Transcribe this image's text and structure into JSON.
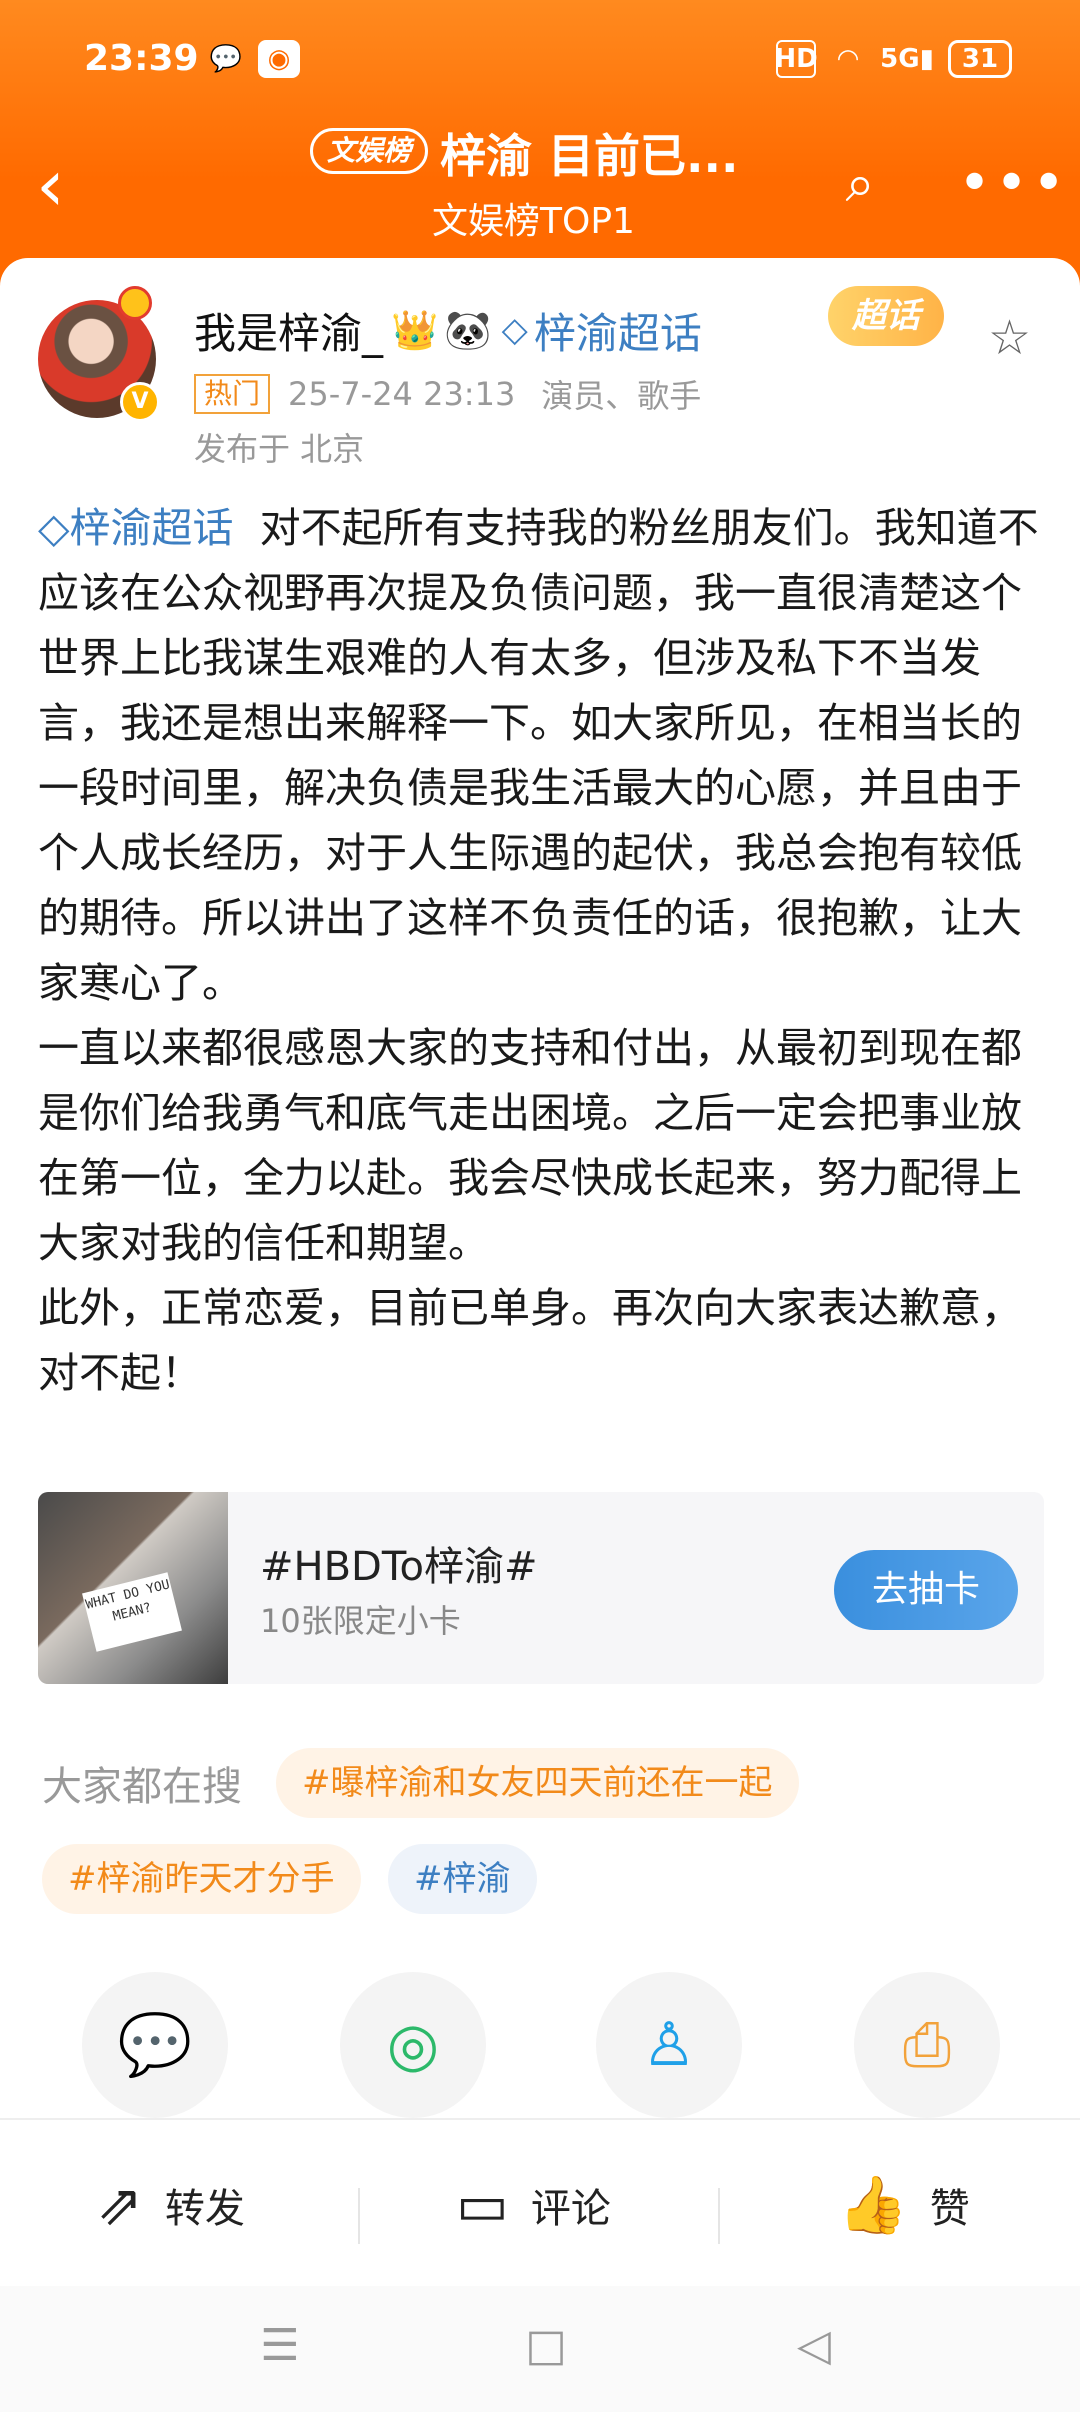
{
  "status_bar": {
    "time": "23:39",
    "hd": "HD",
    "signal": "5G",
    "battery": "31"
  },
  "nav": {
    "back_label": "‹",
    "tag": "文娱榜",
    "title": "梓渝 目前已...",
    "subtitle": "文娱榜TOP1",
    "more_label": "•••"
  },
  "post": {
    "username": "我是梓渝_",
    "supertopic": "梓渝超话",
    "supertopic_badge": "超话",
    "hot_label": "热门",
    "time": "25-7-24 23:13",
    "tags": "演员、歌手",
    "location": "发布于 北京",
    "link_text": "梓渝超话",
    "body_first": "  对不起所有支持我的粉丝朋友们。我知道不应该在公众视野再次提及负债问题，我一直很清楚这个世界上比我谋生艰难的人有太多，但涉及私下不当发言，我还是想出来解释一下。如大家所见，在相当长的一段时间里，解决负债是我生活最大的心愿，并且由于个人成长经历，对于人生际遇的起伏，我总会抱有较低的期待。所以讲出了这样不负责任的话，很抱歉，让大家寒心了。",
    "body_second": "一直以来都很感恩大家的支持和付出，从最初到现在都是你们给我勇气和底气走出困境。之后一定会把事业放在第一位，全力以赴。我会尽快成长起来，努力配得上大家对我的信任和期望。",
    "body_third": "此外，正常恋爱，目前已单身。再次向大家表达歉意，对不起！"
  },
  "promo": {
    "sign_text": "WHAT DO YOU MEAN?",
    "title": "#HBDTo梓渝#",
    "subtitle": "10张限定小卡",
    "button": "去抽卡"
  },
  "search": {
    "label": "大家都在搜",
    "chips": [
      "#曝梓渝和女友四天前还在一起",
      "#梓渝昨天才分手",
      "#梓渝"
    ]
  },
  "actions": {
    "repost": "转发",
    "comment": "评论",
    "like": "赞"
  }
}
